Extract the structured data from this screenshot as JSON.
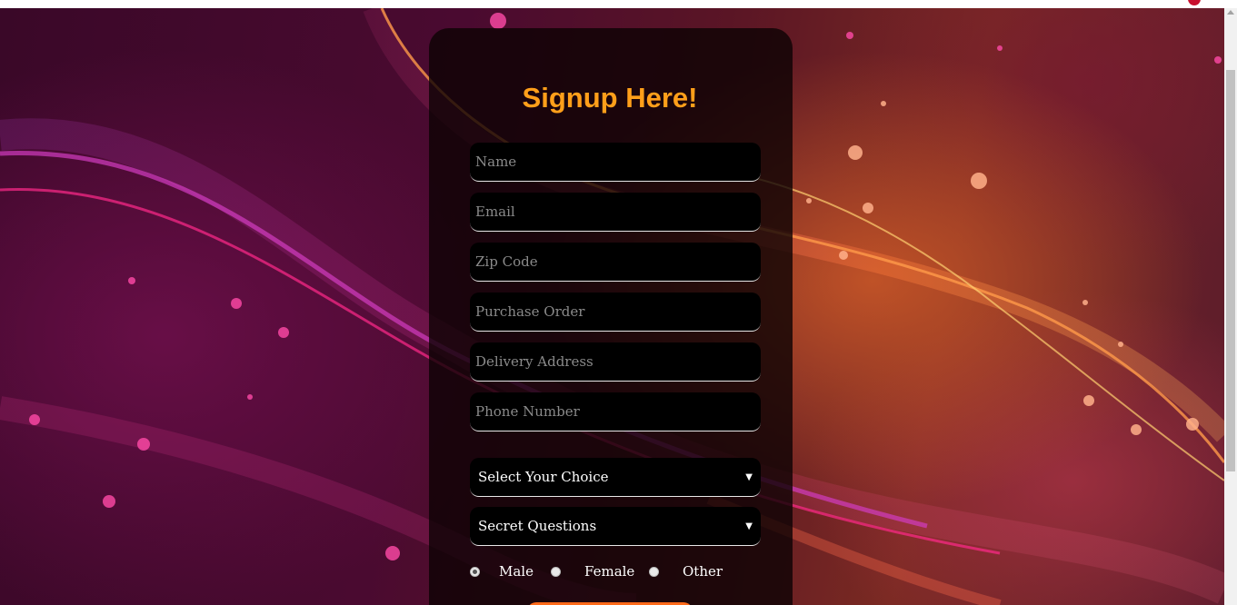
{
  "form": {
    "title": "Signup Here!",
    "fields": [
      {
        "id": "name",
        "placeholder": "Name"
      },
      {
        "id": "email",
        "placeholder": "Email"
      },
      {
        "id": "zip",
        "placeholder": "Zip Code"
      },
      {
        "id": "purchase_order",
        "placeholder": "Purchase Order"
      },
      {
        "id": "delivery_address",
        "placeholder": "Delivery Address"
      },
      {
        "id": "phone",
        "placeholder": "Phone Number"
      }
    ],
    "selects": [
      {
        "id": "choice",
        "selected": "Select Your Choice"
      },
      {
        "id": "secret",
        "selected": "Secret Questions"
      }
    ],
    "caret_glyph": "▼",
    "gender_options": [
      {
        "label": "Male",
        "checked": true
      },
      {
        "label": "Female",
        "checked": false
      },
      {
        "label": "Other",
        "checked": false
      }
    ]
  },
  "colors": {
    "title": "#ff9f1a",
    "field_bg": "#000000",
    "submit": "#ff6a1a"
  }
}
